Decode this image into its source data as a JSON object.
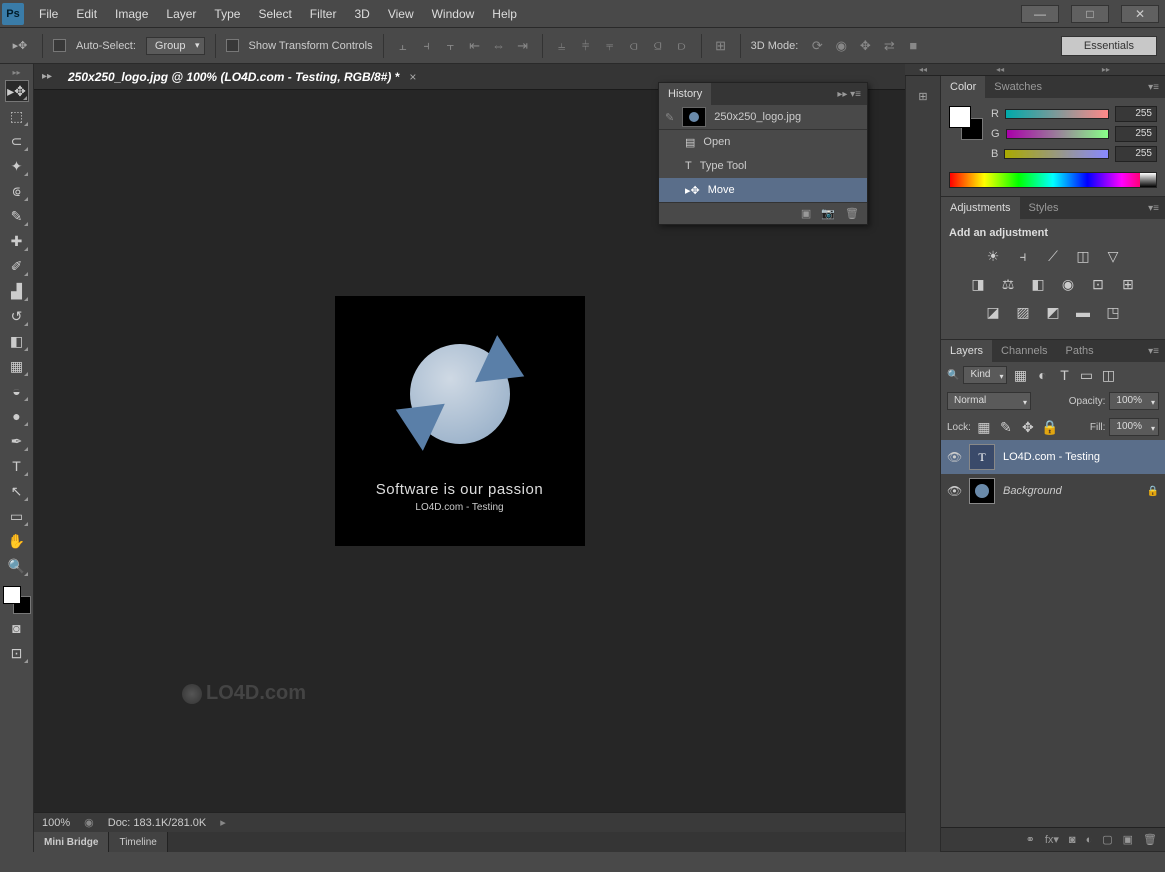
{
  "menus": [
    "File",
    "Edit",
    "Image",
    "Layer",
    "Type",
    "Select",
    "Filter",
    "3D",
    "View",
    "Window",
    "Help"
  ],
  "options": {
    "auto_select": "Auto-Select:",
    "group": "Group",
    "show_transform": "Show Transform Controls",
    "mode_3d": "3D Mode:",
    "workspace": "Essentials"
  },
  "doc": {
    "tab_title": "250x250_logo.jpg @ 100% (LO4D.com - Testing, RGB/8#) *",
    "zoom": "100%",
    "doc_size": "Doc: 183.1K/281.0K"
  },
  "artboard": {
    "line1": "Software is our passion",
    "line2": "LO4D.com - Testing"
  },
  "watermark": "LO4D.com",
  "bottom_tabs": [
    "Mini Bridge",
    "Timeline"
  ],
  "history": {
    "title": "History",
    "source": "250x250_logo.jpg",
    "items": [
      "Open",
      "Type Tool",
      "Move"
    ]
  },
  "color": {
    "tab1": "Color",
    "tab2": "Swatches",
    "r": "R",
    "g": "G",
    "b": "B",
    "rv": "255",
    "gv": "255",
    "bv": "255"
  },
  "adjustments": {
    "tab1": "Adjustments",
    "tab2": "Styles",
    "title": "Add an adjustment"
  },
  "layers": {
    "tab1": "Layers",
    "tab2": "Channels",
    "tab3": "Paths",
    "kind": "Kind",
    "blend": "Normal",
    "opacity_lbl": "Opacity:",
    "opacity": "100%",
    "lock_lbl": "Lock:",
    "fill_lbl": "Fill:",
    "fill": "100%",
    "items": [
      {
        "name": "LO4D.com - Testing",
        "type": "T"
      },
      {
        "name": "Background",
        "type": "bg"
      }
    ]
  }
}
